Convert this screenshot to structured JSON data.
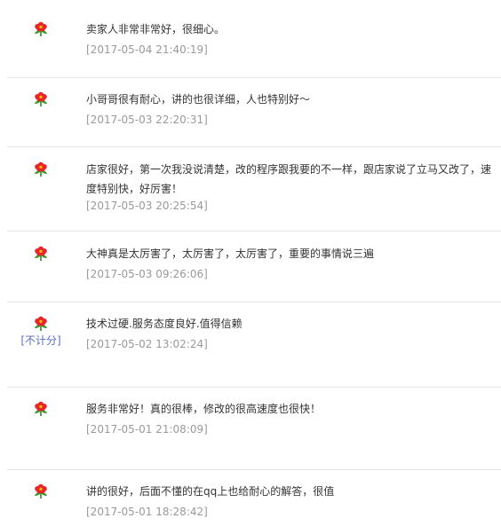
{
  "reviews": [
    {
      "text": "卖家人非常非常好，很细心。",
      "time": "[2017-05-04 21:40:19]",
      "note": ""
    },
    {
      "text": "小哥哥很有耐心，讲的也很详细，人也特别好～",
      "time": "[2017-05-03 22:20:31]",
      "note": ""
    },
    {
      "text": "店家很好，第一次我没说清楚，改的程序跟我要的不一样，跟店家说了立马又改了，速度特别快，好厉害！",
      "time": "[2017-05-03 20:25:54]",
      "note": ""
    },
    {
      "text": "大神真是太厉害了，太厉害了，太厉害了，重要的事情说三遍",
      "time": "[2017-05-03 09:26:06]",
      "note": ""
    },
    {
      "text": "技术过硬.服务态度良好.值得信赖",
      "time": "[2017-05-02 13:02:24]",
      "note": "[不计分]"
    },
    {
      "text": "服务非常好！真的很棒，修改的很高速度也很快！",
      "time": "[2017-05-01 21:08:09]",
      "note": ""
    },
    {
      "text": "讲的很好，后面不懂的在qq上也给耐心的解答，很值",
      "time": "[2017-05-01 18:28:42]",
      "note": ""
    }
  ],
  "colors": {
    "flower_red": "#e8252a",
    "flower_green": "#3a9a2a",
    "note": "#5a6ec0"
  }
}
